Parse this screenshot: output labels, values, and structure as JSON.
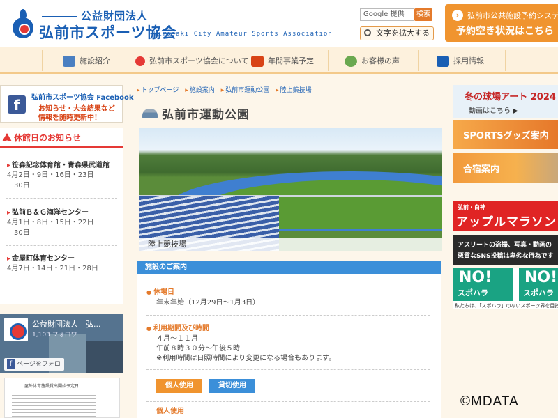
{
  "header": {
    "org_type": "公益財団法人",
    "org_name": "弘前市スポーツ協会",
    "org_english": "Hirosaki City Amateur Sports Association",
    "search_label": "Google 提供",
    "search_button": "検索",
    "zoom_label": "文字を拡大する",
    "reserve_line1": "弘前市公共施設予約システム",
    "reserve_line2": "予約空き状況はこちら"
  },
  "nav": {
    "items": [
      {
        "label": "施設紹介",
        "icon": "building-icon",
        "color": "#4a7fc1"
      },
      {
        "label": "弘前市スポーツ協会について",
        "icon": "logo-icon",
        "color": "#e53935"
      },
      {
        "label": "年間事業予定",
        "icon": "calendar-icon",
        "color": "#d84315"
      },
      {
        "label": "お客様の声",
        "icon": "chat-icon",
        "color": "#6aa84f"
      },
      {
        "label": "採用情報",
        "icon": "people-icon",
        "color": "#1a5fb4"
      }
    ]
  },
  "sidebar": {
    "fb_banner": {
      "title": "弘前市スポーツ協会 Facebook",
      "line1": "お知らせ・大会結果など",
      "line2": "情報を随時更新中！"
    },
    "closed_title": "休館日のお知らせ",
    "closures": [
      {
        "facility": "笹森記念体育館・青森県武道館",
        "days_line1": "4月2日・9日・16日・23日",
        "days_line2": "30日"
      },
      {
        "facility": "弘前Ｂ＆Ｇ海洋センター",
        "days_line1": "4月1日・8日・15日・22日",
        "days_line2": "30日"
      },
      {
        "facility": "金屋町体育センター",
        "days_line1": "4月7日・14日・21日・28日",
        "days_line2": ""
      }
    ],
    "fb_widget": {
      "name": "公益財団法人　弘...",
      "followers": "1,103 フォロワー",
      "follow_button": "ページをフォロー"
    },
    "doc_title": "屋外体育施設貸出開始予定日"
  },
  "main": {
    "breadcrumb": [
      "トップページ",
      "施設案内",
      "弘前市運動公園",
      "陸上競技場"
    ],
    "title": "弘前市運動公園",
    "photo_caption": "陸上競技場",
    "info_header": "施設のご案内",
    "closed_label": "休場日",
    "closed_text": "年末年始（12月29日～1月3日）",
    "period_label": "利用期間及び時間",
    "period_line1": "４月～１１月",
    "period_line2": "午前８時３０分～午後５時",
    "period_line3": "※利用時間は日照時間により変更になる場合もあります。",
    "btn_individual": "個人使用",
    "btn_rent": "貸切使用",
    "individual_label": "個人使用"
  },
  "right": {
    "winter_title": "冬の球場アート 2024",
    "winter_sub": "動画はこちら ▶",
    "sports_goods": "SPORTSグッズ案内",
    "camp": "合宿案内",
    "apple_small": "弘前・白神",
    "apple_big": "アップルマラソン",
    "athlete_line1": "アスリートの盗撮、写真・動画の",
    "athlete_line2": "悪質なSNS投稿は卑劣な行為です",
    "nosh_no": "NO!",
    "nosh_kata": "スポハラ",
    "nosh_caption": "私たちは、「スポハラ」のないスポーツ界を目指します"
  },
  "watermark": "©MDATA"
}
